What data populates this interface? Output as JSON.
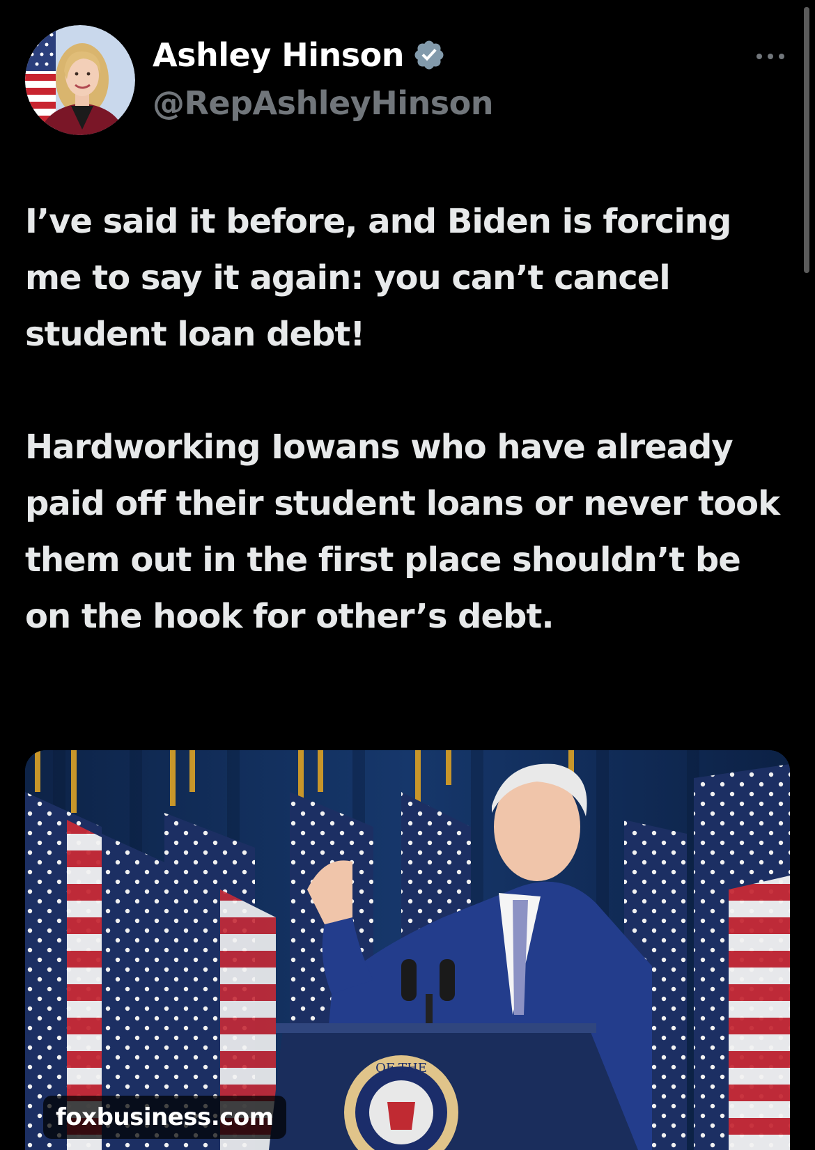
{
  "author": {
    "display_name": "Ashley Hinson",
    "handle": "@RepAshleyHinson",
    "verified_icon": "verified-badge-icon",
    "avatar_icon": "avatar"
  },
  "more_icon": "more-options-icon",
  "tweet": {
    "paragraphs": [
      "I’ve said it before, and Biden is forcing me to say it again: you can’t cancel student loan debt!",
      "Hardworking Iowans who have already paid off their student loans or never took them out in the first place shouldn’t be on the hook for other’s debt."
    ]
  },
  "media": {
    "source": "foxbusiness.com",
    "seal_text": "THE PRESIDENT OF THE UNITED"
  },
  "colors": {
    "background": "#000000",
    "text": "#e7e9ea",
    "secondary": "#71767b",
    "verified": "#829aab"
  }
}
